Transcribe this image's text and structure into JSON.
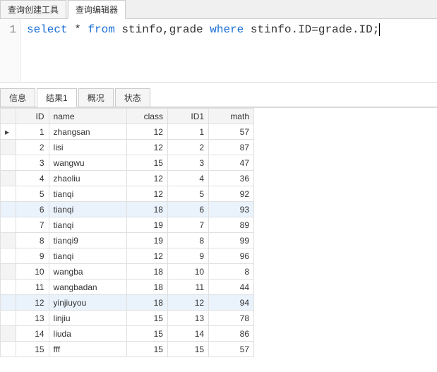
{
  "topTabs": {
    "items": [
      "查询创建工具",
      "查询编辑器"
    ],
    "activeIndex": 1
  },
  "editor": {
    "lineNumber": "1",
    "sql": {
      "kw1": "select",
      "t1": " * ",
      "kw2": "from",
      "t2": " stinfo,grade ",
      "kw3": "where",
      "t3": " stinfo.ID=grade.ID;"
    }
  },
  "resultTabs": {
    "items": [
      "信息",
      "结果1",
      "概况",
      "状态"
    ],
    "activeIndex": 1
  },
  "grid": {
    "columns": [
      "ID",
      "name",
      "class",
      "ID1",
      "math"
    ],
    "rows": [
      {
        "ID": 1,
        "name": "zhangsan",
        "class": 12,
        "ID1": 1,
        "math": 57
      },
      {
        "ID": 2,
        "name": "lisi",
        "class": 12,
        "ID1": 2,
        "math": 87
      },
      {
        "ID": 3,
        "name": "wangwu",
        "class": 15,
        "ID1": 3,
        "math": 47
      },
      {
        "ID": 4,
        "name": "zhaoliu",
        "class": 12,
        "ID1": 4,
        "math": 36
      },
      {
        "ID": 5,
        "name": "tianqi",
        "class": 12,
        "ID1": 5,
        "math": 92
      },
      {
        "ID": 6,
        "name": "tianqi",
        "class": 18,
        "ID1": 6,
        "math": 93
      },
      {
        "ID": 7,
        "name": "tianqi",
        "class": 19,
        "ID1": 7,
        "math": 89
      },
      {
        "ID": 8,
        "name": "tianqi9",
        "class": 19,
        "ID1": 8,
        "math": 99
      },
      {
        "ID": 9,
        "name": "tianqi",
        "class": 12,
        "ID1": 9,
        "math": 96
      },
      {
        "ID": 10,
        "name": "wangba",
        "class": 18,
        "ID1": 10,
        "math": 8
      },
      {
        "ID": 11,
        "name": "wangbadan",
        "class": 18,
        "ID1": 11,
        "math": 44
      },
      {
        "ID": 12,
        "name": "yinjiuyou",
        "class": 18,
        "ID1": 12,
        "math": 94
      },
      {
        "ID": 13,
        "name": "linjiu",
        "class": 15,
        "ID1": 13,
        "math": 78
      },
      {
        "ID": 14,
        "name": "liuda",
        "class": 15,
        "ID1": 14,
        "math": 86
      },
      {
        "ID": 15,
        "name": "fff",
        "class": 15,
        "ID1": 15,
        "math": 57
      }
    ],
    "stripe1": [
      2,
      8,
      14
    ],
    "stripe2": [
      5,
      11
    ],
    "selectedRow": 0
  }
}
